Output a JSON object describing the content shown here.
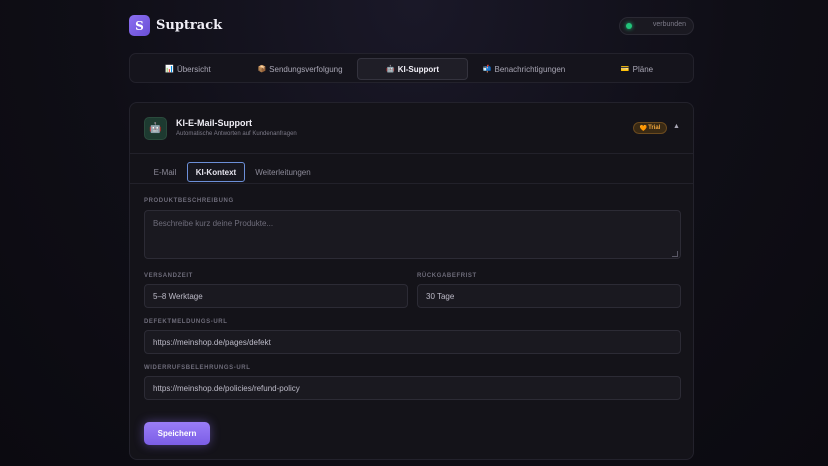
{
  "header": {
    "logo_letter": "S",
    "brand": "Suptrack",
    "status": "verbunden"
  },
  "tabs": [
    {
      "icon": "📊",
      "label": "Übersicht"
    },
    {
      "icon": "📦",
      "label": "Sendungsverfolgung"
    },
    {
      "icon": "🤖",
      "label": "KI-Support"
    },
    {
      "icon": "📬",
      "label": "Benachrichtigungen"
    },
    {
      "icon": "💳",
      "label": "Pläne"
    }
  ],
  "active_tab": "KI-Support",
  "card": {
    "icon": "🤖",
    "title": "KI-E-Mail-Support",
    "subtitle": "Automatische Antworten auf Kundenanfragen",
    "badge_icon": "🧡",
    "badge": "Trial",
    "collapse_icon": "▲"
  },
  "subtabs": [
    "E-Mail",
    "KI-Kontext",
    "Weiterleitungen"
  ],
  "active_subtab": "KI-Kontext",
  "form": {
    "product_label": "PRODUKTBESCHREIBUNG",
    "product_placeholder": "Beschreibe kurz deine Produkte...",
    "shipping_label": "VERSANDZEIT",
    "shipping_value": "5–8 Werktage",
    "return_label": "RÜCKGABEFRIST",
    "return_value": "30 Tage",
    "defect_label": "DEFEKTMELDUNGS-URL",
    "defect_value": "https://meinshop.de/pages/defekt",
    "withdrawal_label": "WIDERRUFSBELEHRUNGS-URL",
    "withdrawal_value": "https://meinshop.de/policies/refund-policy",
    "save_label": "Speichern"
  },
  "colors": {
    "accent": "#8b6ff0",
    "status_green": "#22c47a",
    "trial_orange": "#f0a63e",
    "active_subtab_border": "#6c8fd8"
  }
}
